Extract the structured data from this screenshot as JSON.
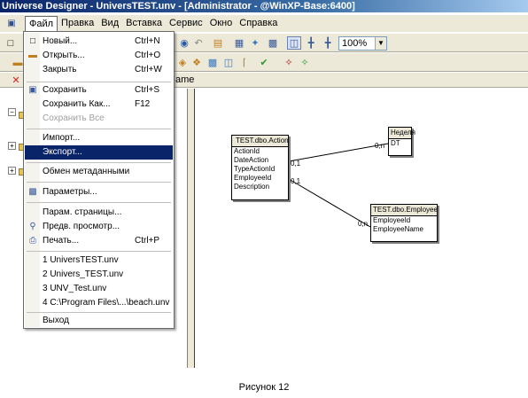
{
  "window": {
    "title": "Universe Designer - UniversTEST.unv - [Administrator - @WinXP-Base:6400]"
  },
  "menubar": {
    "items": [
      {
        "label": "Файл"
      },
      {
        "label": "Правка"
      },
      {
        "label": "Вид"
      },
      {
        "label": "Вставка"
      },
      {
        "label": "Сервис"
      },
      {
        "label": "Окно"
      },
      {
        "label": "Справка"
      }
    ]
  },
  "toolbar": {
    "zoom": "100%",
    "name_fragment": "ame"
  },
  "file_menu": {
    "new": {
      "label": "Новый...",
      "shortcut": "Ctrl+N"
    },
    "open": {
      "label": "Открыть...",
      "shortcut": "Ctrl+O"
    },
    "close": {
      "label": "Закрыть",
      "shortcut": "Ctrl+W"
    },
    "save": {
      "label": "Сохранить",
      "shortcut": "Ctrl+S"
    },
    "save_as": {
      "label": "Сохранить Как...",
      "shortcut": "F12"
    },
    "save_all": {
      "label": "Сохранить Все"
    },
    "import": {
      "label": "Импорт..."
    },
    "export": {
      "label": "Экспорт..."
    },
    "metadata": {
      "label": "Обмен метаданными"
    },
    "params": {
      "label": "Параметры..."
    },
    "page_setup": {
      "label": "Парам. страницы..."
    },
    "preview": {
      "label": "Предв. просмотр..."
    },
    "print": {
      "label": "Печать...",
      "shortcut": "Ctrl+P"
    },
    "recent": [
      "1 UniversTEST.unv",
      "2 Univers_TEST.unv",
      "3 UNV_Test.unv",
      "4 C:\\Program Files\\...\\beach.unv"
    ],
    "exit": {
      "label": "Выход"
    }
  },
  "schema": {
    "tables": {
      "action": {
        "name": "TEST.dbo.Action",
        "columns": [
          "ActionId",
          "DateAction",
          "TypeActionId",
          "EmployeeId",
          "Description"
        ]
      },
      "week": {
        "name": "Неделя",
        "columns": [
          "DT"
        ]
      },
      "employee": {
        "name": "TEST.dbo.Employee",
        "columns": [
          "EmployeeId",
          "EmployeeName"
        ]
      }
    },
    "cardinalities": {
      "action_week_left": "0,1",
      "action_week_right": "0,n",
      "action_emp_left": "0,1",
      "action_emp_right": "0,n"
    }
  },
  "caption": "Рисунок 12",
  "colors": {
    "highlight": "#0a246a",
    "titlebar": "#0a246a",
    "chrome": "#ece9d8"
  }
}
